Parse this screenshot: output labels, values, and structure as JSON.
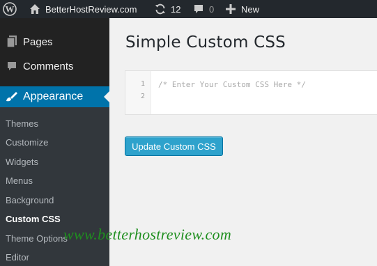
{
  "admin_bar": {
    "site_name": "BetterHostReview.com",
    "updates_count": "12",
    "comments_count": "0",
    "new_label": "New",
    "icons": [
      "wordpress-logo-icon",
      "home-icon",
      "updates-icon",
      "comment-bubble-icon",
      "plus-icon"
    ]
  },
  "sidebar": {
    "menu": [
      {
        "label": "Pages",
        "icon": "pages-icon"
      },
      {
        "label": "Comments",
        "icon": "comments-icon"
      },
      {
        "label": "Appearance",
        "icon": "paintbrush-icon",
        "active": true
      }
    ],
    "submenu": [
      {
        "label": "Themes"
      },
      {
        "label": "Customize"
      },
      {
        "label": "Widgets"
      },
      {
        "label": "Menus"
      },
      {
        "label": "Background"
      },
      {
        "label": "Custom CSS",
        "current": true
      },
      {
        "label": "Theme Options"
      },
      {
        "label": "Editor"
      }
    ]
  },
  "main": {
    "title": "Simple Custom CSS",
    "editor": {
      "line_numbers": [
        "1",
        "2"
      ],
      "line1": "/* Enter Your Custom CSS Here */"
    },
    "update_button": "Update Custom CSS"
  },
  "watermark": "www.betterhostreview.com",
  "colors": {
    "admin_bar_bg": "#23282d",
    "sidebar_bg": "#222222",
    "submenu_bg": "#32373c",
    "accent": "#0073aa",
    "button": "#2ea2cc",
    "watermark": "#1f8f1f"
  }
}
